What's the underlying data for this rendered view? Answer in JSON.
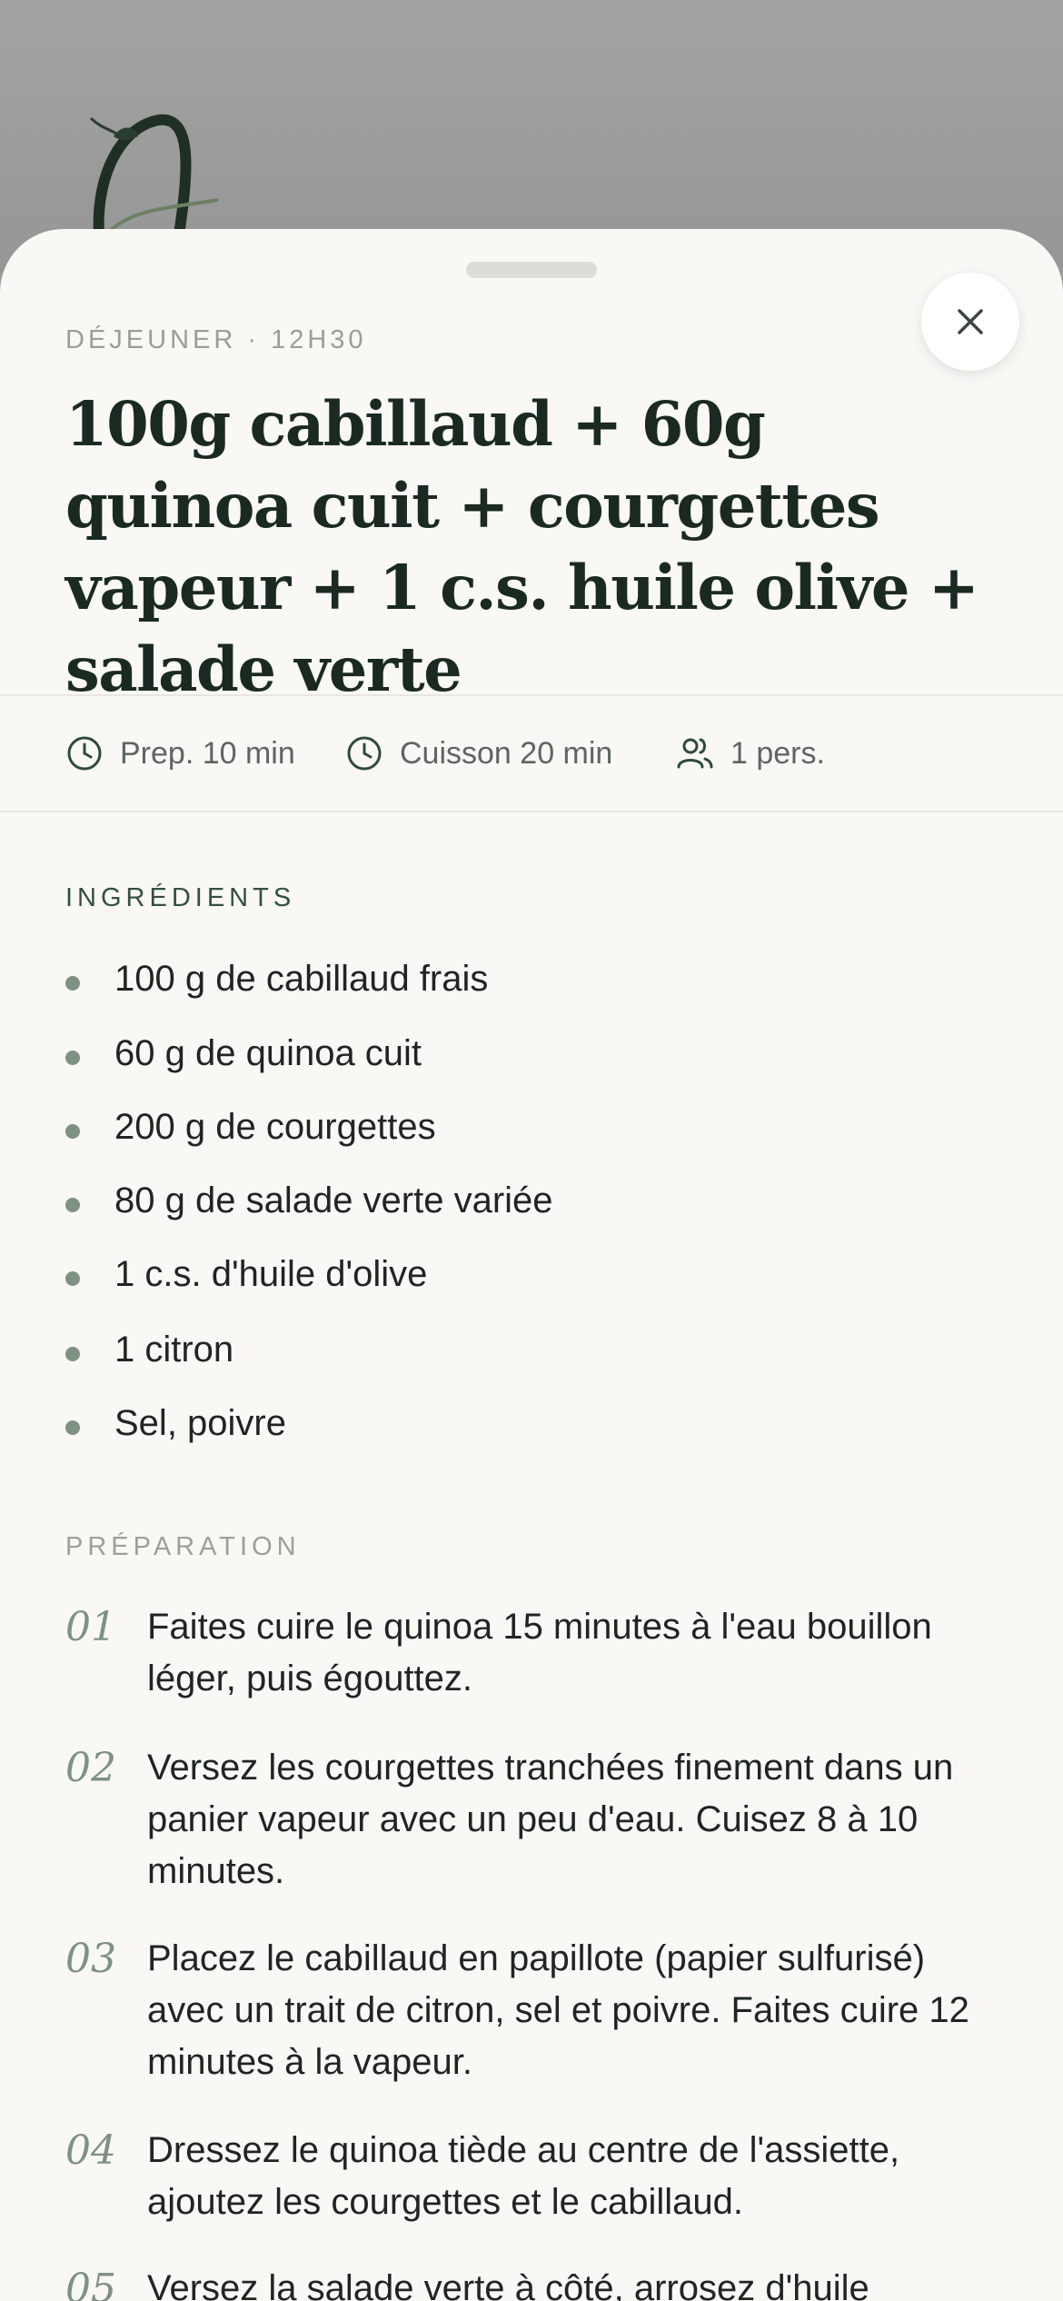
{
  "meal": {
    "eyebrow": "DÉJEUNER · 12H30",
    "title": "100g cabillaud + 60g quinoa cuit + courgettes vapeur + 1 c.s. huile olive + salade verte"
  },
  "meta": {
    "prep": "Prep. 10 min",
    "cook": "Cuisson 20 min",
    "servings": "1 pers."
  },
  "ingredients": {
    "label": "INGRÉDIENTS",
    "items": [
      "100 g de cabillaud frais",
      "60 g de quinoa cuit",
      "200 g de courgettes",
      "80 g de salade verte variée",
      "1 c.s. d'huile d'olive",
      "1 citron",
      "Sel, poivre"
    ]
  },
  "preparation": {
    "label": "PRÉPARATION",
    "steps": [
      {
        "num": "01",
        "text": "Faites cuire le quinoa 15 minutes à l'eau bouillon léger, puis égouttez."
      },
      {
        "num": "02",
        "text": "Versez les courgettes tranchées finement dans un panier vapeur avec un peu d'eau. Cuisez 8 à 10 minutes."
      },
      {
        "num": "03",
        "text": "Placez le cabillaud en papillote (papier sulfurisé) avec un trait de citron, sel et poivre. Faites cuire 12 minutes à la vapeur."
      },
      {
        "num": "04",
        "text": "Dressez le quinoa tiède au centre de l'assiette, ajoutez les courgettes et le cabillaud."
      },
      {
        "num": "05",
        "text": "Versez la salade verte à côté, arrosez d'huile"
      }
    ]
  },
  "icons": {
    "close": "close-icon",
    "prep": "clock-icon",
    "cook": "clock-icon",
    "servings": "people-icon"
  },
  "colors": {
    "accent": "#7e9182",
    "title": "#1b2a20",
    "sheet": "#f9f8f5",
    "backdrop": "#9b9b9b"
  }
}
